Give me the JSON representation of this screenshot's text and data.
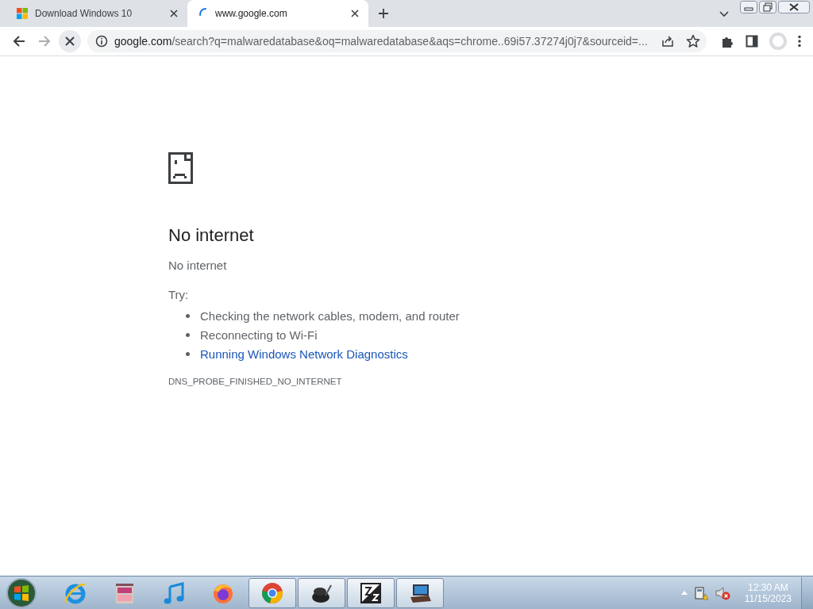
{
  "tabs": [
    {
      "title": "Download Windows 10",
      "selected": false,
      "loading": false
    },
    {
      "title": "www.google.com",
      "selected": true,
      "loading": true
    }
  ],
  "address": {
    "host": "google.com",
    "rest": "/search?q=malwaredatabase&oq=malwaredatabase&aqs=chrome..69i57.37274j0j7&sourceid=..."
  },
  "error": {
    "title": "No internet",
    "message": "No internet",
    "try_label": "Try:",
    "suggestions": [
      {
        "text": "Checking the network cables, modem, and router",
        "kind": "text"
      },
      {
        "text": "Reconnecting to Wi-Fi",
        "kind": "text"
      },
      {
        "text": "Running Windows Network Diagnostics",
        "kind": "link"
      }
    ],
    "code": "DNS_PROBE_FINISHED_NO_INTERNET"
  },
  "taskbar": {
    "apps": [
      {
        "kind": "ie",
        "running": false
      },
      {
        "kind": "archive",
        "running": false
      },
      {
        "kind": "music",
        "running": false
      },
      {
        "kind": "firefox",
        "running": false
      },
      {
        "kind": "chrome",
        "running": true
      },
      {
        "kind": "ink",
        "running": true
      },
      {
        "kind": "filezilla",
        "running": true
      },
      {
        "kind": "laptop",
        "running": true
      }
    ],
    "clock": {
      "time": "12:30 AM",
      "date": "11/15/2023"
    }
  }
}
